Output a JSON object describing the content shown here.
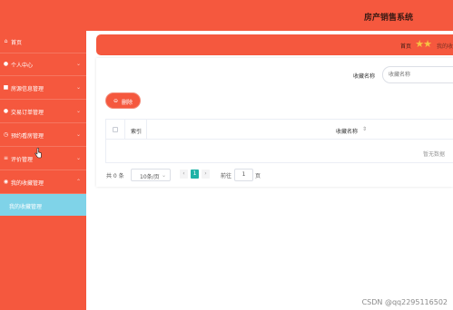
{
  "header": {
    "title": "房产销售系统"
  },
  "sidebar": {
    "items": [
      {
        "label": "首页",
        "icon": "home-icon",
        "glyph": "⌂",
        "chevron": ""
      },
      {
        "label": "个人中心",
        "icon": "user-icon",
        "glyph": "●",
        "chevron": "⌄"
      },
      {
        "label": "房源信息管理",
        "icon": "house-icon",
        "glyph": "■",
        "chevron": "⌄"
      },
      {
        "label": "交易订单管理",
        "icon": "user-icon",
        "glyph": "●",
        "chevron": "⌄"
      },
      {
        "label": "预约看房管理",
        "icon": "calendar-icon",
        "glyph": "◷",
        "chevron": "⌄"
      },
      {
        "label": "评价管理",
        "icon": "list-icon",
        "glyph": "≡",
        "chevron": "⌄"
      },
      {
        "label": "我的收藏管理",
        "icon": "star-icon",
        "glyph": "◉",
        "chevron": "⌃"
      }
    ],
    "sub_item": "我的收藏管理"
  },
  "breadcrumb": {
    "home": "首页",
    "current": "我的收"
  },
  "search": {
    "label": "收藏名称",
    "placeholder": "收藏名称"
  },
  "toolbar": {
    "delete_icon": "⊖",
    "delete_label": "删除"
  },
  "table": {
    "columns": [
      "索引",
      "收藏名称"
    ],
    "sort_glyph": "⇕",
    "empty_text": "暂无数据"
  },
  "pagination": {
    "total": "共 0 条",
    "page_size": "10条/页",
    "current_page": "1",
    "goto_label": "前往",
    "goto_value": "1",
    "page_unit": "页"
  },
  "watermark": "CSDN @qq2295116502",
  "colors": {
    "accent": "#f5583e",
    "sub_active": "#7fd3e8",
    "page_active": "#1eb2a6"
  }
}
